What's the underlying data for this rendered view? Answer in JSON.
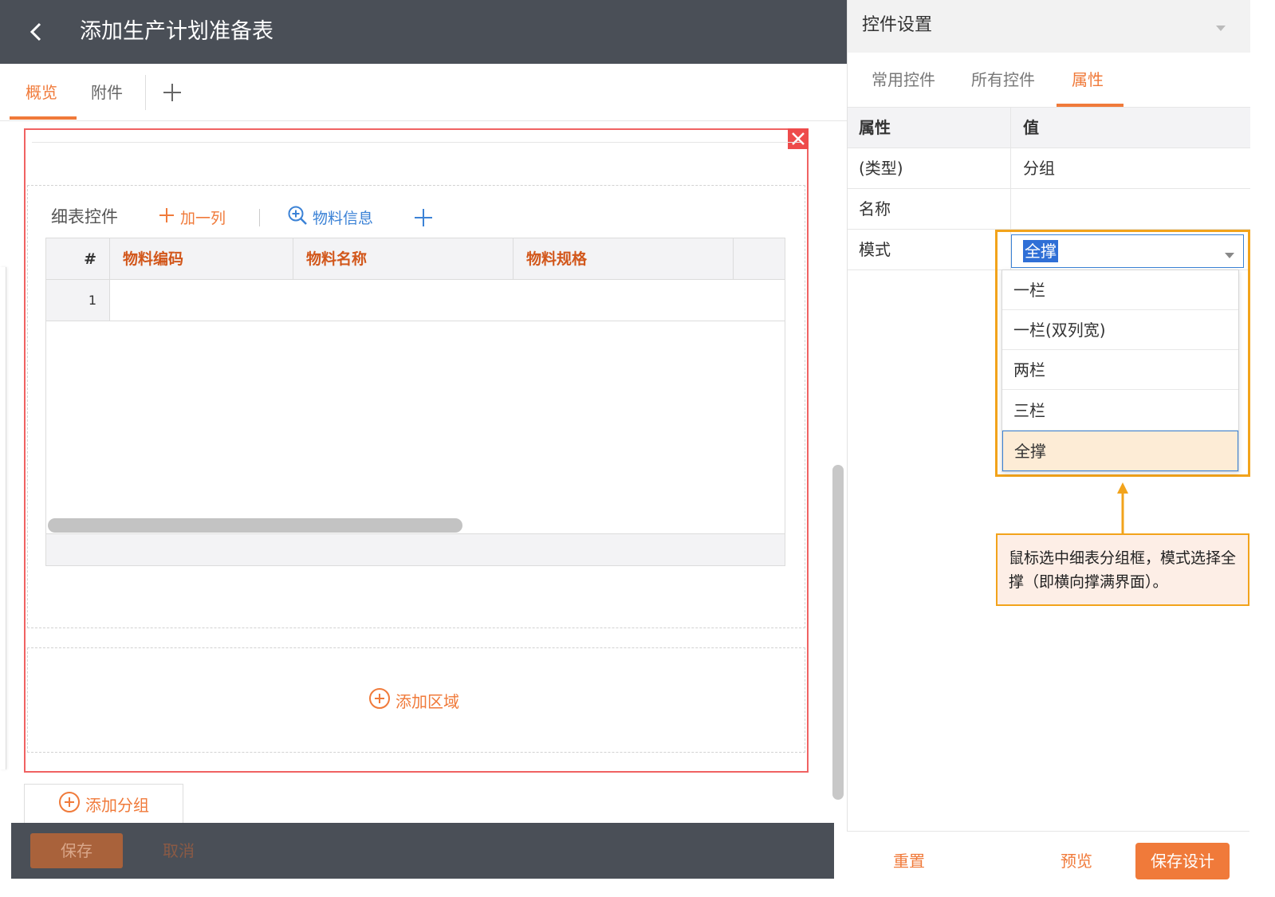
{
  "header": {
    "title": "添加生产计划准备表"
  },
  "tabs": [
    {
      "label": "概览",
      "active": true
    },
    {
      "label": "附件",
      "active": false
    }
  ],
  "detail": {
    "label": "细表控件",
    "add_column": "加一列",
    "material_info": "物料信息",
    "columns": [
      "#",
      "物料编码",
      "物料名称",
      "物料规格"
    ],
    "rows": [
      {
        "num": "1"
      }
    ]
  },
  "add_area": "添加区域",
  "add_group": "添加分组",
  "footer": {
    "save": "保存",
    "cancel": "取消"
  },
  "panel": {
    "title": "控件设置",
    "tabs": [
      {
        "label": "常用控件"
      },
      {
        "label": "所有控件"
      },
      {
        "label": "属性",
        "active": true
      }
    ],
    "table_headers": {
      "property": "属性",
      "value": "值"
    },
    "rows": [
      {
        "key": "(类型)",
        "value": "分组"
      },
      {
        "key": "名称",
        "value": ""
      },
      {
        "key": "模式",
        "value": "全撑"
      }
    ],
    "mode_options": [
      "一栏",
      "一栏(双列宽)",
      "两栏",
      "三栏",
      "全撑"
    ],
    "callout": "鼠标选中细表分组框，模式选择全撑（即横向撑满界面）。",
    "footer": {
      "reset": "重置",
      "preview": "预览",
      "save_design": "保存设计"
    }
  },
  "colors": {
    "accent": "#f07a3a",
    "link": "#3b82d6",
    "header_bg": "#4a4f57",
    "group_border": "#f06262",
    "highlight": "#f2a31b"
  }
}
